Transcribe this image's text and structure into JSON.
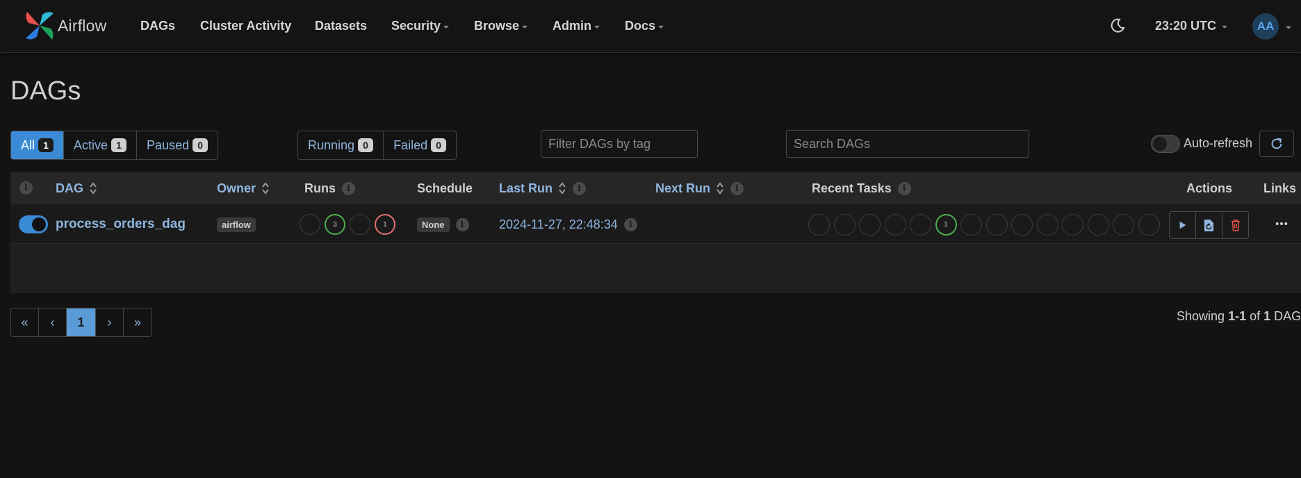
{
  "brand": {
    "name": "Airflow"
  },
  "nav": {
    "items": [
      {
        "label": "DAGs",
        "dropdown": false
      },
      {
        "label": "Cluster Activity",
        "dropdown": false
      },
      {
        "label": "Datasets",
        "dropdown": false
      },
      {
        "label": "Security",
        "dropdown": true
      },
      {
        "label": "Browse",
        "dropdown": true
      },
      {
        "label": "Admin",
        "dropdown": true
      },
      {
        "label": "Docs",
        "dropdown": true
      }
    ],
    "clock": "23:20 UTC",
    "user_initials": "AA"
  },
  "page": {
    "title": "DAGs"
  },
  "filters": {
    "status": [
      {
        "label": "All",
        "count": "1",
        "active": true
      },
      {
        "label": "Active",
        "count": "1",
        "active": false
      },
      {
        "label": "Paused",
        "count": "0",
        "active": false
      }
    ],
    "state": [
      {
        "label": "Running",
        "count": "0"
      },
      {
        "label": "Failed",
        "count": "0"
      }
    ],
    "tag_placeholder": "Filter DAGs by tag",
    "search_placeholder": "Search DAGs",
    "auto_refresh_label": "Auto-refresh"
  },
  "table": {
    "headers": {
      "dag": "DAG",
      "owner": "Owner",
      "runs": "Runs",
      "schedule": "Schedule",
      "last_run": "Last Run",
      "next_run": "Next Run",
      "recent_tasks": "Recent Tasks",
      "actions": "Actions",
      "links": "Links"
    },
    "info_glyph": "i",
    "rows": [
      {
        "dag_id": "process_orders_dag",
        "paused": false,
        "owner": "airflow",
        "runs": [
          {
            "state": "queued",
            "count": ""
          },
          {
            "state": "success",
            "count": "3"
          },
          {
            "state": "running",
            "count": ""
          },
          {
            "state": "failed",
            "count": "1"
          }
        ],
        "schedule": "None",
        "last_run": "2024-11-27, 22:48:34",
        "recent_tasks": [
          {
            "state": "",
            "count": ""
          },
          {
            "state": "",
            "count": ""
          },
          {
            "state": "",
            "count": ""
          },
          {
            "state": "",
            "count": ""
          },
          {
            "state": "",
            "count": ""
          },
          {
            "state": "success",
            "count": "1"
          },
          {
            "state": "",
            "count": ""
          },
          {
            "state": "",
            "count": ""
          },
          {
            "state": "",
            "count": ""
          },
          {
            "state": "",
            "count": ""
          },
          {
            "state": "",
            "count": ""
          },
          {
            "state": "",
            "count": ""
          },
          {
            "state": "",
            "count": ""
          },
          {
            "state": "",
            "count": ""
          }
        ]
      }
    ]
  },
  "pagination": {
    "first": "«",
    "prev": "‹",
    "current": "1",
    "next": "›",
    "last": "»"
  },
  "summary": {
    "prefix": "Showing ",
    "range": "1-1",
    "of": " of ",
    "total": "1",
    "suffix": " DAGs"
  },
  "colors": {
    "accent": "#3b8ad6",
    "success": "#4cb04c",
    "failed": "#e07070",
    "link": "#8fb6df"
  }
}
